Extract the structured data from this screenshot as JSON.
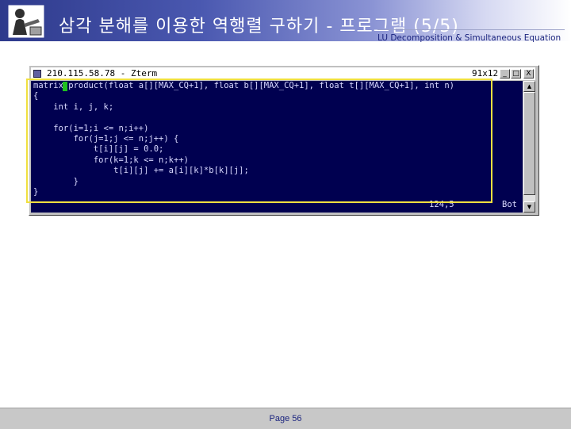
{
  "slide": {
    "title": "삼각 분해를 이용한 역행렬 구하기 - 프로그램 (5/5)",
    "subtitle": "LU Decomposition & Simultaneous Equation",
    "page_label": "Page 56"
  },
  "terminal": {
    "window_title": "210.115.58.78 - Zterm",
    "size_label": "91x12",
    "buttons": {
      "minimize": "_",
      "maximize": "□",
      "close": "X"
    },
    "code": "matrix product(float a[][MAX_CQ+1], float b[][MAX_CQ+1], float t[][MAX_CQ+1], int n)\n{\n    int i, j, k;\n\n    for(i=1;i <= n;i++)\n        for(j=1;j <= n;j++) {\n            t[i][j] = 0.0;\n            for(k=1;k <= n;k++)\n                t[i][j] += a[i][k]*b[k][j];\n        }\n}",
    "status_position": "124,5",
    "status_mode": "Bot"
  },
  "colors": {
    "terminal_bg": "#000050",
    "terminal_text": "#d8d8ff",
    "highlight": "#f0e040",
    "cursor": "#20c020"
  },
  "icons": [
    "presenter-logo-icon",
    "terminal-system-icon",
    "minimize-icon",
    "maximize-icon",
    "close-icon",
    "scroll-up-icon",
    "scroll-down-icon"
  ]
}
